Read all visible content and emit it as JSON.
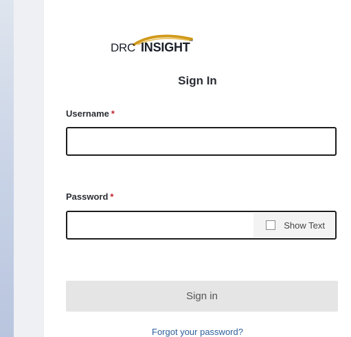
{
  "logo": {
    "part1": "DRC",
    "part2": "INSIGHT",
    "tm": "™",
    "swoosh_color": "#d19a1c"
  },
  "form": {
    "title": "Sign In",
    "username_label": "Username",
    "password_label": "Password",
    "required_mark": "*",
    "username_value": "",
    "password_value": "",
    "show_text_label": "Show Text",
    "show_text_checked": false,
    "signin_label": "Sign in",
    "forgot_label": "Forgot your password?"
  },
  "colors": {
    "required": "#c0232c",
    "link": "#2d5f9a",
    "button_disabled_bg": "#e5e5e5"
  }
}
